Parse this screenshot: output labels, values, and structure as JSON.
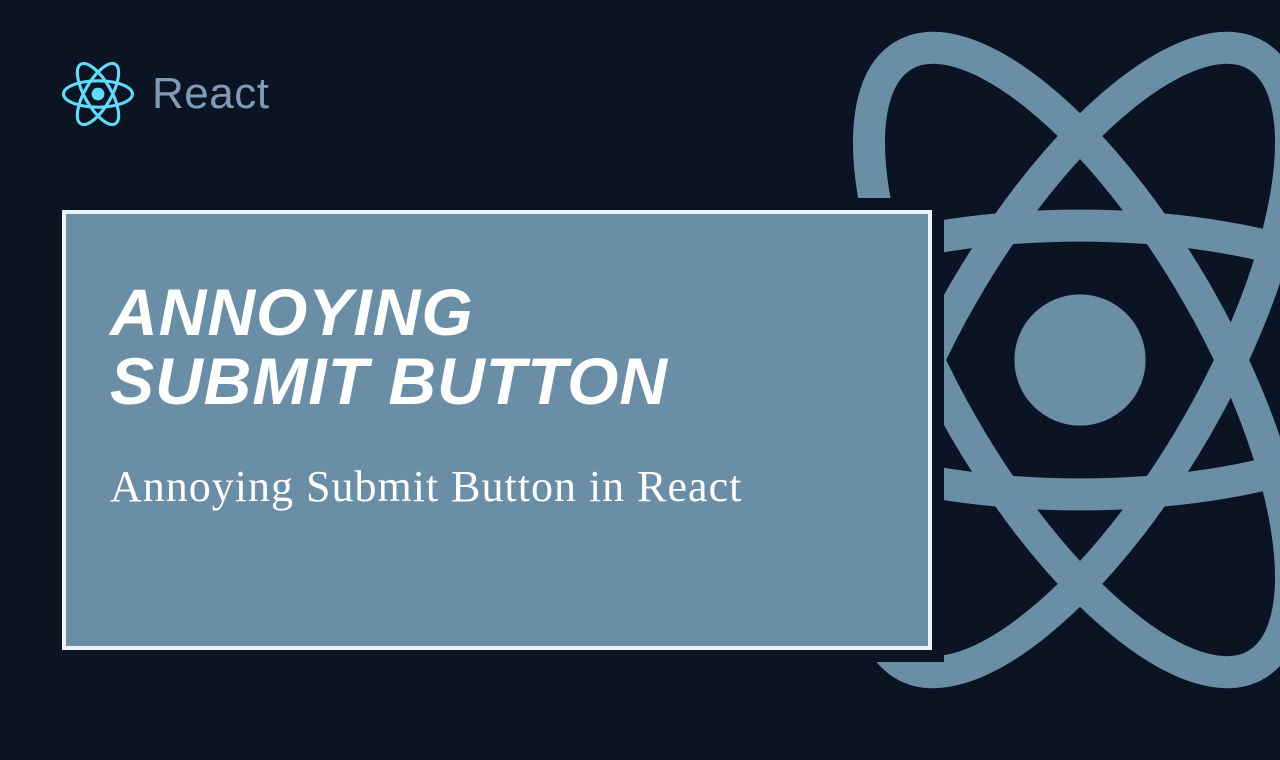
{
  "logo": {
    "name": "React"
  },
  "card": {
    "title_line1": "ANNOYING",
    "title_line2": "SUBMIT BUTTON",
    "subtitle": "Annoying Submit Button in React"
  },
  "colors": {
    "background": "#0b1423",
    "card_bg": "#6a8ea6",
    "card_border": "#eef2f4",
    "react_blue": "#61dafb",
    "bg_atom": "#6a8ea6"
  }
}
